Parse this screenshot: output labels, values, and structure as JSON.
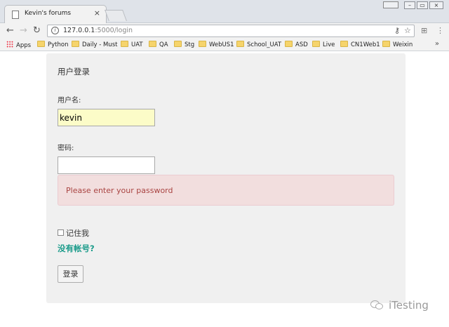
{
  "browser": {
    "tab_title": "Kevin's forums",
    "tab_close": "×",
    "window_label": "",
    "url_host": "127.0.0.1",
    "url_port": ":5000",
    "url_path": "/login",
    "bookmarks": [
      {
        "label": "Apps",
        "icon": "apps-grid-icon"
      },
      {
        "label": "Python",
        "icon": "folder-icon"
      },
      {
        "label": "Daily - Must",
        "icon": "folder-icon"
      },
      {
        "label": "UAT",
        "icon": "folder-icon"
      },
      {
        "label": "QA",
        "icon": "folder-icon"
      },
      {
        "label": "Stg",
        "icon": "folder-icon"
      },
      {
        "label": "WebUS1",
        "icon": "folder-icon"
      },
      {
        "label": "School_UAT",
        "icon": "folder-icon"
      },
      {
        "label": "ASD",
        "icon": "folder-icon"
      },
      {
        "label": "Live",
        "icon": "folder-icon"
      },
      {
        "label": "CN1Web1",
        "icon": "folder-icon"
      },
      {
        "label": "Weixin",
        "icon": "folder-icon"
      }
    ],
    "more": "»"
  },
  "login": {
    "heading": "用户登录",
    "username_label": "用户名:",
    "username_value": "kevin",
    "password_label": "密码:",
    "password_value": "",
    "error_message": "Please enter your password",
    "remember_label": "记住我",
    "register_link": "没有帐号?",
    "submit_label": "登录"
  },
  "watermark": {
    "text": "iTesting"
  },
  "colors": {
    "alert_bg": "#f2dede",
    "alert_text": "#a94442",
    "link": "#1a9b8a",
    "autofill_bg": "#fcfcc8"
  }
}
